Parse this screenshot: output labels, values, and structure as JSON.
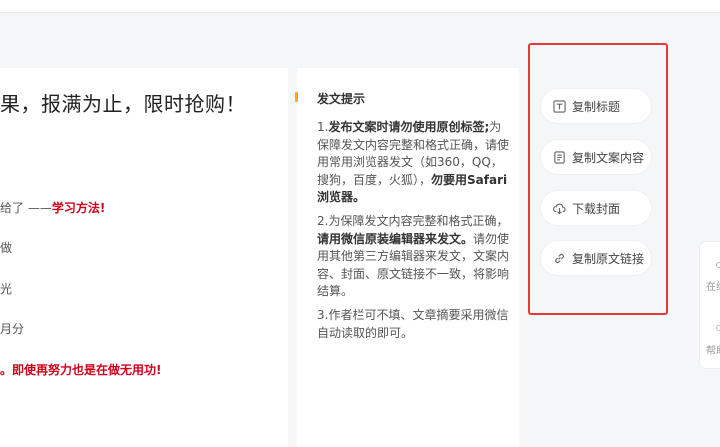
{
  "article": {
    "title": "果，报满为止，限时抢购！",
    "lines": [
      {
        "prefix": "给了 ——",
        "highlight": "学习方法!"
      },
      {
        "text": "做"
      },
      {
        "text": "光"
      },
      {
        "text": "月分"
      },
      {
        "text": "。即使再努力也是在做无用功!"
      }
    ]
  },
  "tips": {
    "title": "发文提示",
    "items": [
      {
        "p1": "1.",
        "b1": "发布文案时请勿使用原创标签;",
        "p2": "为保障发文内容完整和格式正确，请使用常用浏览器发文（如360，QQ，搜狗，百度，火狐），",
        "b2": "勿要用Safari浏览器。"
      },
      {
        "p1": "2.为保障发文内容完整和格式正确，",
        "b1": "请用微信原装编辑器来发文。",
        "p2": "请勿使用其他第三方编辑器来发文，文案内容、封面、原文链接不一致，将影响结算。"
      },
      {
        "text": "3.作者栏可不填、文章摘要采用微信自动读取的即可。"
      }
    ]
  },
  "actions": [
    {
      "label": "复制标题",
      "icon": "title-icon"
    },
    {
      "label": "复制文案内容",
      "icon": "document-icon"
    },
    {
      "label": "下载封面",
      "icon": "cloud-download-icon"
    },
    {
      "label": "复制原文链接",
      "icon": "link-icon"
    }
  ],
  "edge": {
    "text1": "在线",
    "text2": "帮助"
  },
  "colors": {
    "highlight_border": "#e53935",
    "accent": "#f5a623",
    "red_text": "#d0021b"
  }
}
